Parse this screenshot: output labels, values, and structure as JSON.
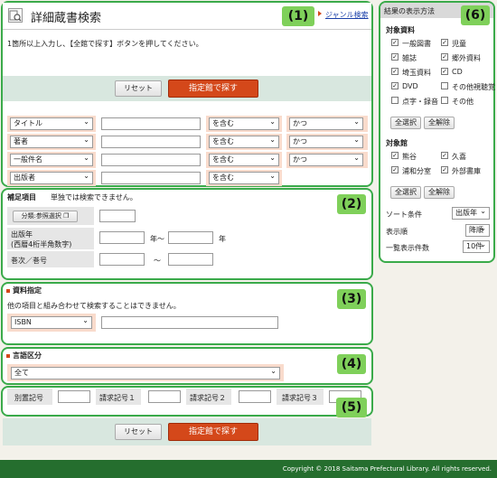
{
  "header": {
    "title": "詳細蔵書検索",
    "genre_link": "ジャンル検索"
  },
  "badges": [
    "(1)",
    "(2)",
    "(3)",
    "(4)",
    "(5)",
    "(6)"
  ],
  "instruction": "1箇所以上入力し、【全館で探す】ボタンを押してください。",
  "buttons": {
    "reset": "リセット",
    "search": "指定館で探す"
  },
  "search_rows": [
    {
      "field": "タイトル",
      "match": "を含む",
      "conj": "かつ"
    },
    {
      "field": "著者",
      "match": "を含む",
      "conj": "かつ"
    },
    {
      "field": "一般件名",
      "match": "を含む",
      "conj": "かつ"
    },
    {
      "field": "出版者",
      "match": "を含む",
      "conj": ""
    }
  ],
  "supplement": {
    "title": "補足項目",
    "note": "単独では検索できません。",
    "class_button": "分類:参照選択",
    "pub_year_label": "出版年",
    "pub_year_hint": "(西暦4桁半角数字)",
    "year_from": "年～",
    "year_to": "年",
    "volume_label": "巻次／巻号",
    "tilde": "～"
  },
  "material": {
    "title": "資料指定",
    "note": "他の項目と組み合わせて検索することはできません。",
    "type": "ISBN"
  },
  "language": {
    "title": "言語区分",
    "value": "全て"
  },
  "call_numbers": {
    "separate": "別置記号",
    "call1": "請求記号１",
    "call2": "請求記号２",
    "call3": "請求記号３"
  },
  "sidebar": {
    "title": "結果の表示方法",
    "materials_title": "対象資料",
    "materials": [
      {
        "label": "一般図書",
        "checked": true
      },
      {
        "label": "児童",
        "checked": true
      },
      {
        "label": "雑誌",
        "checked": true
      },
      {
        "label": "郷外資料",
        "checked": true
      },
      {
        "label": "埼玉資料",
        "checked": true
      },
      {
        "label": "CD",
        "checked": true
      },
      {
        "label": "DVD",
        "checked": true
      },
      {
        "label": "その他視聴覚",
        "checked": false
      },
      {
        "label": "点字・録音",
        "checked": false
      },
      {
        "label": "その他",
        "checked": false
      }
    ],
    "select_all": "全選択",
    "clear_all": "全解除",
    "libraries_title": "対象館",
    "libraries": [
      {
        "label": "熊谷",
        "checked": true
      },
      {
        "label": "久喜",
        "checked": true
      },
      {
        "label": "浦和分室",
        "checked": true
      },
      {
        "label": "外部書庫",
        "checked": true
      }
    ],
    "sort_label": "ソート条件",
    "sort_value": "出版年",
    "order_label": "表示順",
    "order_value": "降順",
    "count_label": "一覧表示件数",
    "count_value": "10件"
  },
  "footer": "Copyright © 2018 Saitama Prefectural Library. All rights reserved."
}
